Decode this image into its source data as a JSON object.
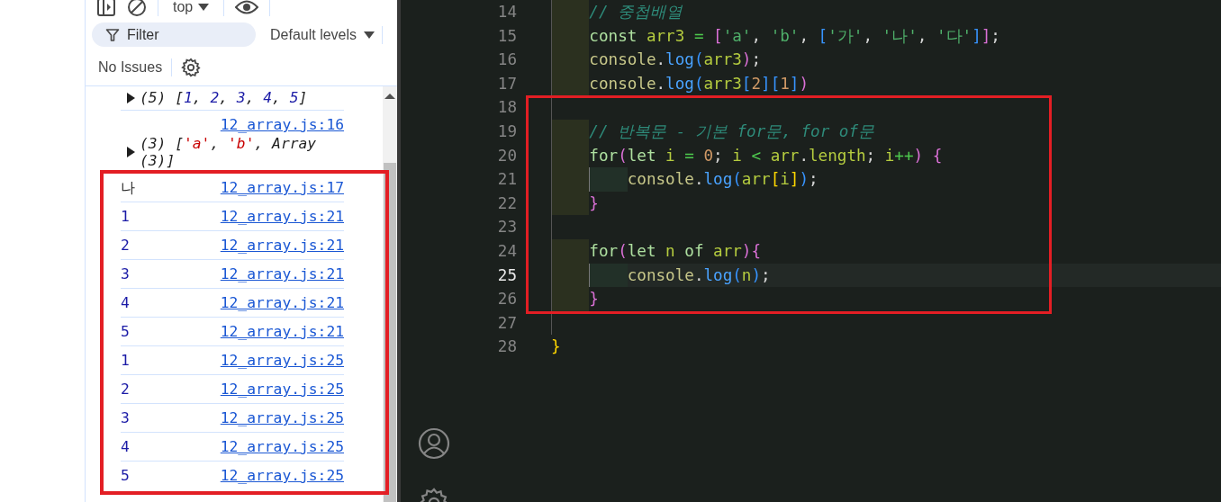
{
  "console": {
    "toolbar": {
      "context": "top"
    },
    "filter": {
      "placeholder": "Filter"
    },
    "levels": "Default levels",
    "issues": "No Issues",
    "messages": [
      {
        "kind": "object",
        "expanded": false,
        "tokens": [
          {
            "kind": "plain",
            "text": "(5) ["
          },
          {
            "kind": "num",
            "text": "1"
          },
          {
            "kind": "plain",
            "text": ", "
          },
          {
            "kind": "num",
            "text": "2"
          },
          {
            "kind": "plain",
            "text": ", "
          },
          {
            "kind": "num",
            "text": "3"
          },
          {
            "kind": "plain",
            "text": ", "
          },
          {
            "kind": "num",
            "text": "4"
          },
          {
            "kind": "plain",
            "text": ", "
          },
          {
            "kind": "num",
            "text": "5"
          },
          {
            "kind": "plain",
            "text": "]"
          }
        ]
      },
      {
        "kind": "object",
        "expanded": false,
        "link": "12_array.js:16",
        "tokens": [
          {
            "kind": "plain",
            "text": "(3) ["
          },
          {
            "kind": "str",
            "text": "'a'"
          },
          {
            "kind": "plain",
            "text": ", "
          },
          {
            "kind": "str",
            "text": "'b'"
          },
          {
            "kind": "plain",
            "text": ", Array (3)]"
          }
        ]
      }
    ],
    "framed_messages": [
      {
        "kind": "value",
        "link": "12_array.js:17",
        "tokens": [
          {
            "kind": "text",
            "text": "나"
          }
        ]
      },
      {
        "kind": "value",
        "link": "12_array.js:21",
        "tokens": [
          {
            "kind": "num",
            "text": "1"
          }
        ]
      },
      {
        "kind": "value",
        "link": "12_array.js:21",
        "tokens": [
          {
            "kind": "num",
            "text": "2"
          }
        ]
      },
      {
        "kind": "value",
        "link": "12_array.js:21",
        "tokens": [
          {
            "kind": "num",
            "text": "3"
          }
        ]
      },
      {
        "kind": "value",
        "link": "12_array.js:21",
        "tokens": [
          {
            "kind": "num",
            "text": "4"
          }
        ]
      },
      {
        "kind": "value",
        "link": "12_array.js:21",
        "tokens": [
          {
            "kind": "num",
            "text": "5"
          }
        ]
      },
      {
        "kind": "value",
        "link": "12_array.js:25",
        "tokens": [
          {
            "kind": "num",
            "text": "1"
          }
        ]
      },
      {
        "kind": "value",
        "link": "12_array.js:25",
        "tokens": [
          {
            "kind": "num",
            "text": "2"
          }
        ]
      },
      {
        "kind": "value",
        "link": "12_array.js:25",
        "tokens": [
          {
            "kind": "num",
            "text": "3"
          }
        ]
      },
      {
        "kind": "value",
        "link": "12_array.js:25",
        "tokens": [
          {
            "kind": "num",
            "text": "4"
          }
        ]
      },
      {
        "kind": "value",
        "link": "12_array.js:25",
        "tokens": [
          {
            "kind": "num",
            "text": "5"
          }
        ]
      }
    ]
  },
  "editor": {
    "lines": [
      {
        "number": "14",
        "current": false,
        "tokens": [
          {
            "kind": "indent"
          },
          {
            "kind": "comment",
            "text": "// 중첩배열"
          }
        ]
      },
      {
        "number": "15",
        "current": false,
        "tokens": [
          {
            "kind": "indent"
          },
          {
            "kind": "kw",
            "text": "const "
          },
          {
            "kind": "var",
            "text": "arr3 "
          },
          {
            "kind": "op",
            "text": "= "
          },
          {
            "kind": "b1",
            "text": "["
          },
          {
            "kind": "str",
            "text": "'a'"
          },
          {
            "kind": "punct",
            "text": ", "
          },
          {
            "kind": "str",
            "text": "'b'"
          },
          {
            "kind": "punct",
            "text": ", "
          },
          {
            "kind": "b2",
            "text": "["
          },
          {
            "kind": "str",
            "text": "'가'"
          },
          {
            "kind": "punct",
            "text": ", "
          },
          {
            "kind": "str",
            "text": "'나'"
          },
          {
            "kind": "punct",
            "text": ", "
          },
          {
            "kind": "str",
            "text": "'다'"
          },
          {
            "kind": "b2",
            "text": "]"
          },
          {
            "kind": "b1",
            "text": "]"
          },
          {
            "kind": "punct",
            "text": ";"
          }
        ]
      },
      {
        "number": "16",
        "current": false,
        "tokens": [
          {
            "kind": "indent"
          },
          {
            "kind": "obj",
            "text": "console"
          },
          {
            "kind": "punct",
            "text": "."
          },
          {
            "kind": "fn",
            "text": "log"
          },
          {
            "kind": "b2",
            "text": "("
          },
          {
            "kind": "var",
            "text": "arr3"
          },
          {
            "kind": "b1",
            "text": ")"
          },
          {
            "kind": "punct",
            "text": ";"
          }
        ]
      },
      {
        "number": "17",
        "current": false,
        "tokens": [
          {
            "kind": "indent"
          },
          {
            "kind": "obj",
            "text": "console"
          },
          {
            "kind": "punct",
            "text": "."
          },
          {
            "kind": "fn",
            "text": "log"
          },
          {
            "kind": "b2",
            "text": "("
          },
          {
            "kind": "var",
            "text": "arr3"
          },
          {
            "kind": "b2",
            "text": "["
          },
          {
            "kind": "num",
            "text": "2"
          },
          {
            "kind": "b2",
            "text": "]["
          },
          {
            "kind": "num",
            "text": "1"
          },
          {
            "kind": "b2",
            "text": "]"
          },
          {
            "kind": "b1",
            "text": ")"
          }
        ]
      }
    ],
    "framed_lines": [
      {
        "number": "18",
        "current": false,
        "tokens": [
          {
            "kind": "guide"
          }
        ]
      },
      {
        "number": "19",
        "current": false,
        "tokens": [
          {
            "kind": "indent"
          },
          {
            "kind": "comment",
            "text": "// 반복문 - 기본 for문, for of문"
          }
        ]
      },
      {
        "number": "20",
        "current": false,
        "tokens": [
          {
            "kind": "indent"
          },
          {
            "kind": "kw",
            "text": "for"
          },
          {
            "kind": "b1",
            "text": "("
          },
          {
            "kind": "kw",
            "text": "let "
          },
          {
            "kind": "var",
            "text": "i "
          },
          {
            "kind": "op",
            "text": "= "
          },
          {
            "kind": "num",
            "text": "0"
          },
          {
            "kind": "punct",
            "text": "; "
          },
          {
            "kind": "var",
            "text": "i "
          },
          {
            "kind": "op",
            "text": "< "
          },
          {
            "kind": "var",
            "text": "arr"
          },
          {
            "kind": "punct",
            "text": "."
          },
          {
            "kind": "var",
            "text": "length"
          },
          {
            "kind": "punct",
            "text": "; "
          },
          {
            "kind": "var",
            "text": "i"
          },
          {
            "kind": "op",
            "text": "++"
          },
          {
            "kind": "b1",
            "text": ") "
          },
          {
            "kind": "b1",
            "text": "{"
          }
        ]
      },
      {
        "number": "21",
        "current": false,
        "tokens": [
          {
            "kind": "indent"
          },
          {
            "kind": "indent2"
          },
          {
            "kind": "obj",
            "text": "console"
          },
          {
            "kind": "punct",
            "text": "."
          },
          {
            "kind": "fn",
            "text": "log"
          },
          {
            "kind": "b2",
            "text": "("
          },
          {
            "kind": "var",
            "text": "arr"
          },
          {
            "kind": "b3",
            "text": "["
          },
          {
            "kind": "var",
            "text": "i"
          },
          {
            "kind": "b3",
            "text": "]"
          },
          {
            "kind": "b2",
            "text": ")"
          },
          {
            "kind": "punct",
            "text": ";"
          }
        ]
      },
      {
        "number": "22",
        "current": false,
        "tokens": [
          {
            "kind": "indent"
          },
          {
            "kind": "b1",
            "text": "}"
          }
        ]
      },
      {
        "number": "23",
        "current": false,
        "tokens": [
          {
            "kind": "guide"
          }
        ]
      },
      {
        "number": "24",
        "current": false,
        "tokens": [
          {
            "kind": "indent"
          },
          {
            "kind": "kw",
            "text": "for"
          },
          {
            "kind": "b1",
            "text": "("
          },
          {
            "kind": "kw",
            "text": "let "
          },
          {
            "kind": "var",
            "text": "n "
          },
          {
            "kind": "kw",
            "text": "of "
          },
          {
            "kind": "var",
            "text": "arr"
          },
          {
            "kind": "b1",
            "text": ")"
          },
          {
            "kind": "b1",
            "text": "{"
          }
        ]
      },
      {
        "number": "25",
        "current": true,
        "tokens": [
          {
            "kind": "indent"
          },
          {
            "kind": "indent2"
          },
          {
            "kind": "obj",
            "text": "console"
          },
          {
            "kind": "punct",
            "text": "."
          },
          {
            "kind": "fn",
            "text": "log"
          },
          {
            "kind": "b2",
            "text": "("
          },
          {
            "kind": "var",
            "text": "n"
          },
          {
            "kind": "b2",
            "text": ")"
          },
          {
            "kind": "punct",
            "text": ";"
          }
        ]
      },
      {
        "number": "26",
        "current": false,
        "tokens": [
          {
            "kind": "indent"
          },
          {
            "kind": "b1",
            "text": "}"
          }
        ]
      }
    ],
    "lines_after": [
      {
        "number": "27",
        "current": false,
        "tokens": [
          {
            "kind": "guide"
          }
        ]
      },
      {
        "number": "28",
        "current": false,
        "tokens": [
          {
            "kind": "b3",
            "text": "}"
          }
        ]
      }
    ]
  }
}
